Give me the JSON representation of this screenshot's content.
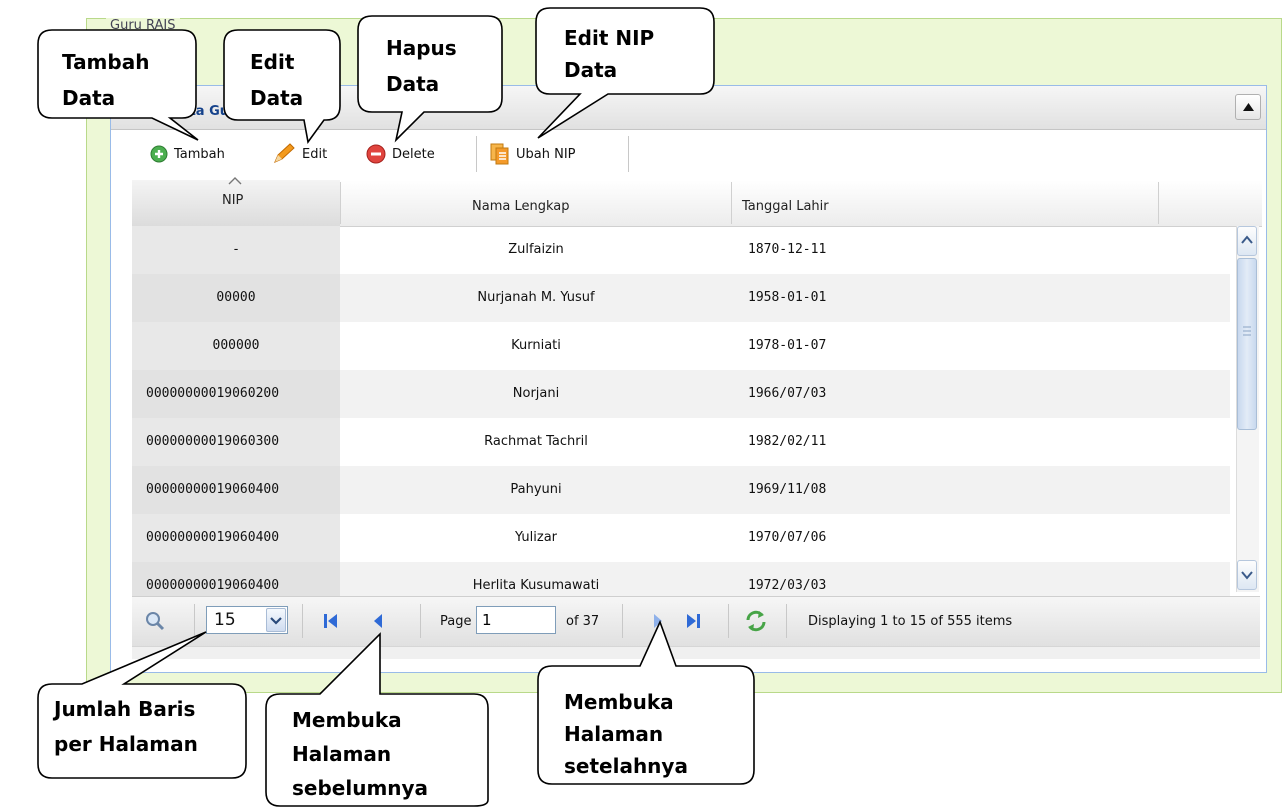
{
  "fieldset": {
    "legend": "Guru RAIS"
  },
  "panel": {
    "title": "Data Guru"
  },
  "toolbar": {
    "add_label": "Tambah",
    "edit_label": "Edit",
    "delete_label": "Delete",
    "change_nip_label": "Ubah NIP"
  },
  "grid": {
    "columns": [
      "NIP",
      "Nama Lengkap",
      "Tanggal Lahir"
    ],
    "rows": [
      {
        "nip": "-",
        "nama": "Zulfaizin",
        "tgl": "1870-12-11"
      },
      {
        "nip": "00000",
        "nama": "Nurjanah M. Yusuf",
        "tgl": "1958-01-01"
      },
      {
        "nip": "000000",
        "nama": "Kurniati",
        "tgl": "1978-01-07"
      },
      {
        "nip": "00000000019060200",
        "nama": "Norjani",
        "tgl": "1966/07/03"
      },
      {
        "nip": "00000000019060300",
        "nama": "Rachmat Tachril",
        "tgl": "1982/02/11"
      },
      {
        "nip": "00000000019060400",
        "nama": "Pahyuni",
        "tgl": "1969/11/08"
      },
      {
        "nip": "00000000019060400",
        "nama": "Yulizar",
        "tgl": "1970/07/06"
      },
      {
        "nip": "00000000019060400",
        "nama": "Herlita Kusumawati",
        "tgl": "1972/03/03"
      }
    ]
  },
  "pager": {
    "page_size": "15",
    "page_label": "Page",
    "page_value": "1",
    "page_of": "of 37",
    "display_info": "Displaying 1 to 15 of 555 items"
  },
  "callouts": {
    "tambah": [
      "Tambah",
      "Data"
    ],
    "edit": [
      "Edit",
      "Data"
    ],
    "hapus": [
      "Hapus",
      "Data"
    ],
    "edit_nip": [
      "Edit NIP",
      "Data"
    ],
    "jumlah": [
      "Jumlah Baris",
      "per Halaman"
    ],
    "sebelum": [
      "Membuka",
      "Halaman",
      "sebelumnya"
    ],
    "setelah": [
      "Membuka",
      "Halaman",
      "setelahnya"
    ]
  },
  "colors": {
    "fieldset_bg": "#edf8d6",
    "panel_border": "#99bbe8",
    "nav_blue": "#2f6ad6",
    "delete_red": "#e0443e",
    "add_green": "#46a84a"
  }
}
